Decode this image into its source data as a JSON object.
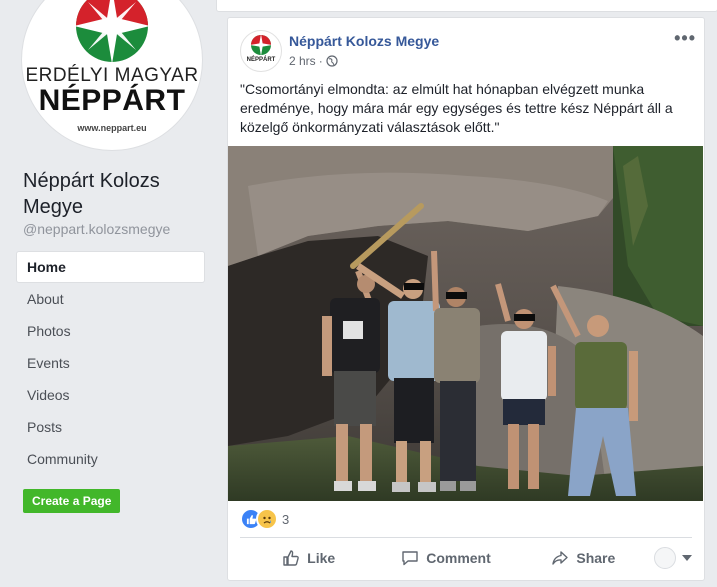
{
  "sidebar": {
    "logo": {
      "line1": "ERDÉLYI MAGYAR",
      "line2": "NÉPPÁRT",
      "url": "www.neppart.eu"
    },
    "page_name": "Néppárt Kolozs Megye",
    "page_handle": "@neppart.kolozsmegye",
    "nav_items": [
      {
        "label": "Home",
        "active": true
      },
      {
        "label": "About"
      },
      {
        "label": "Photos"
      },
      {
        "label": "Events"
      },
      {
        "label": "Videos"
      },
      {
        "label": "Posts"
      },
      {
        "label": "Community"
      }
    ],
    "create_page_label": "Create a Page"
  },
  "post": {
    "author": "Néppárt Kolozs Megye",
    "time": "2 hrs",
    "audience_icon": "globe-icon",
    "more_label": "•••",
    "text": "\"Csomortányi elmondta: az elmúlt hat hónapban elvégzett munka eredménye, hogy mára már egy egységes és tettre kész Néppárt áll a közelgő önkormányzati választások előtt.\"",
    "reactions": {
      "types": [
        "like-icon",
        "sad-icon"
      ],
      "count": "3"
    },
    "actions": {
      "like": "Like",
      "comment": "Comment",
      "share": "Share"
    }
  },
  "colors": {
    "link_blue": "#365899",
    "create_green": "#42b72a",
    "logo_green": "#1c8c3c",
    "logo_red": "#d4222b",
    "background": "#e9ebee"
  }
}
